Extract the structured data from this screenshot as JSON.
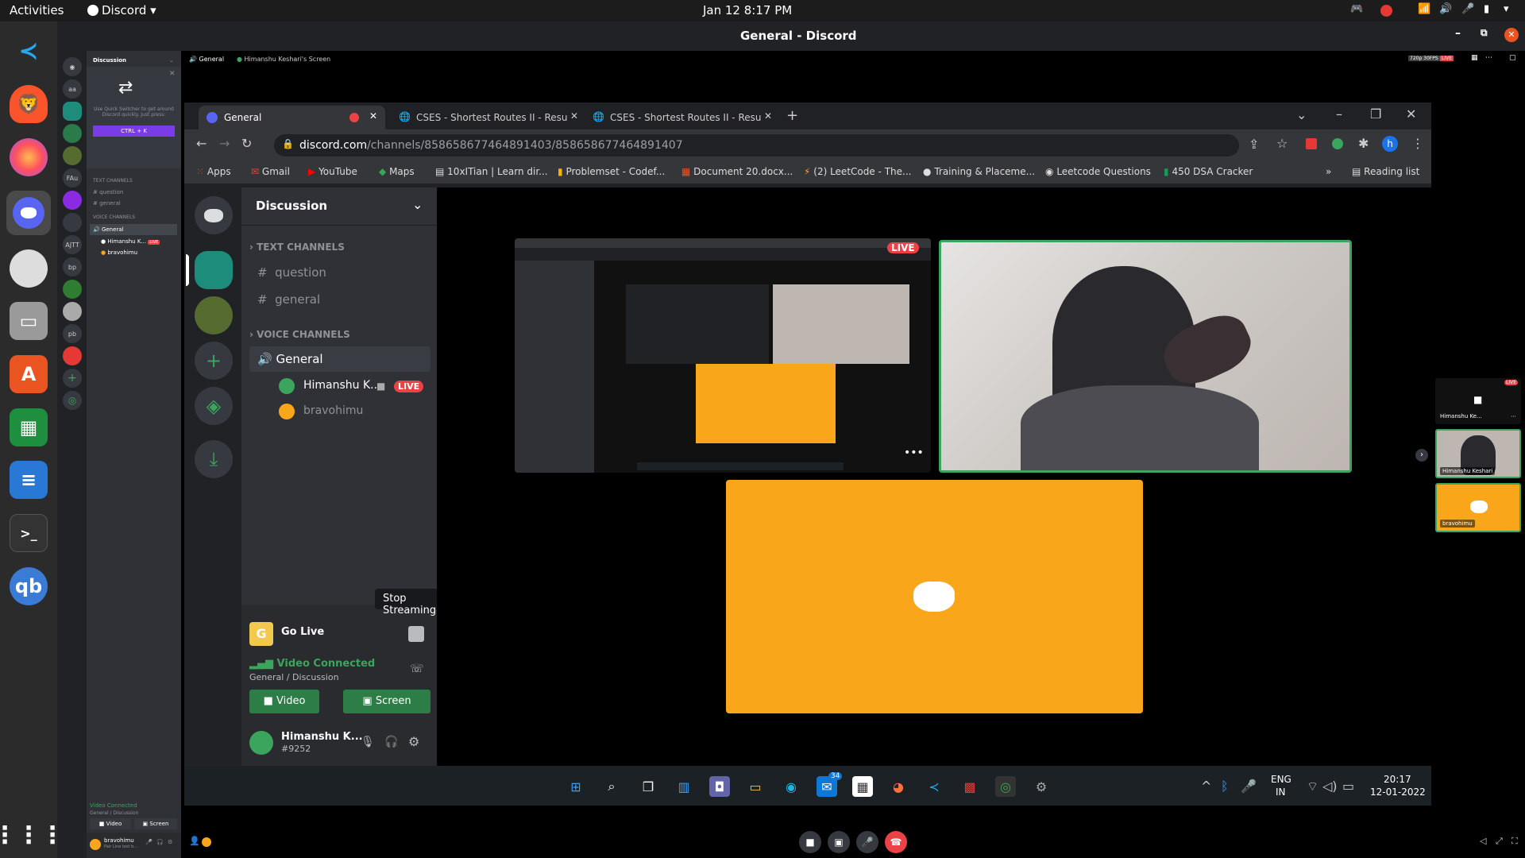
{
  "top_bar": {
    "activities": "Activities",
    "app_name": "Discord",
    "datetime": "Jan 12  8:17 PM"
  },
  "window": {
    "title": "General - Discord"
  },
  "outer_discord": {
    "stream_header": {
      "channel": "General",
      "screen_title": "Himanshu Keshari's Screen",
      "quality_badge": "720p 30FPS",
      "live_badge": "LIVE"
    },
    "server_name": "Discussion",
    "quick_switcher": {
      "text": "Use Quick Switcher to get around Discord quickly. Just press:",
      "shortcut": "CTRL + K"
    },
    "server_icons": [
      "aa",
      "FAu",
      "AJTT",
      "bp",
      "pb"
    ],
    "text_channels_header": "TEXT CHANNELS",
    "text_channels": [
      "question",
      "general"
    ],
    "voice_channels_header": "VOICE CHANNELS",
    "voice_channel": "General",
    "voice_users": [
      {
        "name": "Himanshu K...",
        "live": "LIVE"
      },
      {
        "name": "bravohimu"
      }
    ],
    "footer": {
      "status": "Video Connected",
      "location": "General / Discussion",
      "video": "Video",
      "screen": "Screen",
      "user": "bravohimu",
      "user_tag": "Pair Line test b..."
    }
  },
  "chrome": {
    "tabs": [
      {
        "label": "General"
      },
      {
        "label": "CSES - Shortest Routes II - Result"
      },
      {
        "label": "CSES - Shortest Routes II - Result"
      }
    ],
    "new_tab": "+",
    "url_domain": "discord.com",
    "url_path": "/channels/858658677464891403/858658677464891407",
    "profile_letter": "h",
    "bookmarks": [
      "Apps",
      "Gmail",
      "YouTube",
      "Maps",
      "10xITian | Learn dir...",
      "Problemset - Codef...",
      "Document 20.docx...",
      "(2) LeetCode - The...",
      "Training & Placeme...",
      "Leetcode Questions",
      "450 DSA Cracker"
    ],
    "overflow": "»",
    "reading_list": "Reading list"
  },
  "inner_discord": {
    "server_name": "Discussion",
    "text_channels_header": "TEXT CHANNELS",
    "text_channels": [
      "question",
      "general"
    ],
    "voice_channels_header": "VOICE CHANNELS",
    "voice_channel": "General",
    "voice_users": [
      {
        "name": "Himanshu K...",
        "live": "LIVE"
      },
      {
        "name": "bravohimu"
      }
    ],
    "tooltip": "Stop Streaming",
    "go_live": "Go Live",
    "status": "Video Connected",
    "location": "General / Discussion",
    "video_button": "Video",
    "screen_button": "Screen",
    "user_name": "Himanshu K...",
    "user_tag": "#9252",
    "stream_live_badge": "LIVE"
  },
  "windows_taskbar": {
    "lang_top": "ENG",
    "lang_bottom": "IN",
    "time": "20:17",
    "date": "12-01-2022",
    "mail_badge": "34"
  },
  "side_panel": {
    "tiles": [
      {
        "label": "Himanshu Ke...",
        "live": "LIVE"
      },
      {
        "label": "Himanshu Keshari"
      },
      {
        "label": "bravohimu"
      }
    ]
  },
  "colors": {
    "discord_blurple": "#5865f2",
    "discord_green": "#3ba55d",
    "live_red": "#ed4245",
    "tile_orange": "#faa61a",
    "ubuntu_topbar": "#1c1c1c"
  }
}
